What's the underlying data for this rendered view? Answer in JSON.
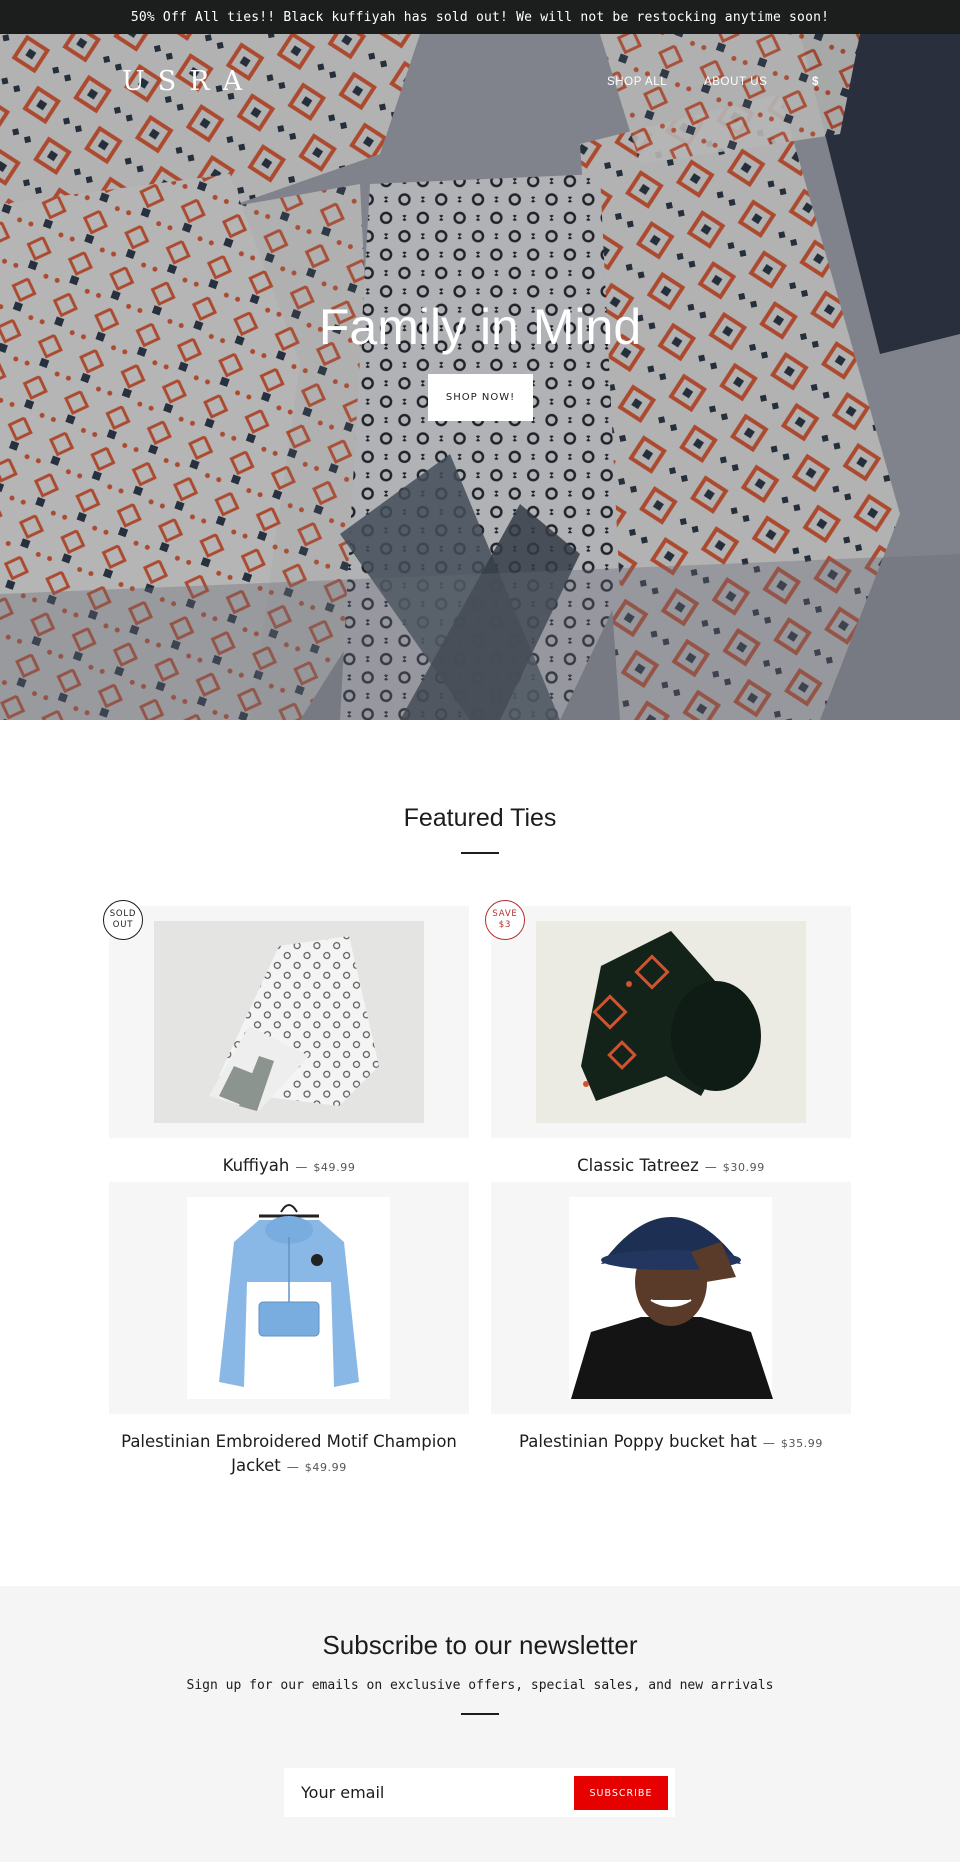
{
  "announcement": "50% Off All ties!! Black kuffiyah has sold out! We will not be restocking anytime soon!",
  "header": {
    "logo": "USRA",
    "nav": [
      "SHOP ALL",
      "ABOUT US"
    ],
    "cart": "$"
  },
  "hero": {
    "title": "Family in Mind",
    "button": "SHOP NOW!"
  },
  "featured": {
    "title": "Featured Ties",
    "products": [
      {
        "name": "Kuffiyah",
        "price": "$49.99",
        "badge": "SOLD\nOUT",
        "badge_type": "sold-out"
      },
      {
        "name": "Classic Tatreez",
        "price": "$30.99",
        "badge": "SAVE\n$3",
        "badge_type": "sale"
      },
      {
        "name": "Palestinian Embroidered Motif Champion Jacket",
        "price": "$49.99"
      },
      {
        "name": "Palestinian Poppy bucket hat",
        "price": "$35.99"
      }
    ],
    "separator": "—"
  },
  "newsletter": {
    "title": "Subscribe to our newsletter",
    "subtitle": "Sign up for our emails on exclusive offers, special sales, and new arrivals",
    "email_placeholder": "Your email",
    "button": "SUBSCRIBE"
  },
  "colors": {
    "announcement_bg": "#1c1d1d",
    "accent_red": "#e60000",
    "sale_badge": "#b22f2f",
    "newsletter_bg": "#f5f5f5"
  }
}
